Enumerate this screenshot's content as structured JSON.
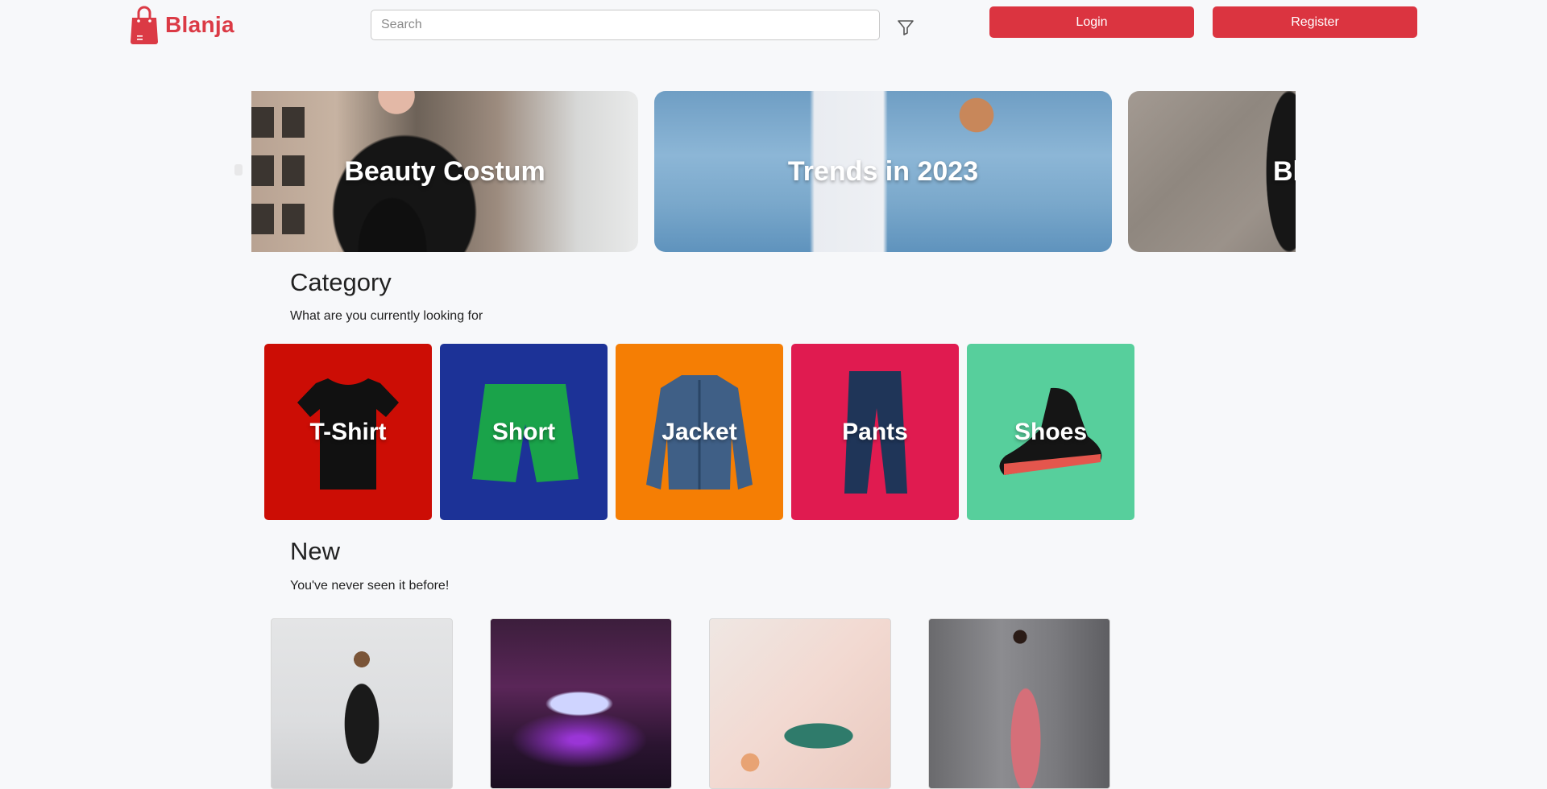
{
  "header": {
    "brand": "Blanja",
    "search": {
      "placeholder": "Search",
      "value": ""
    },
    "login_label": "Login",
    "register_label": "Register"
  },
  "banners": [
    {
      "title": "Beauty Costum"
    },
    {
      "title": "Trends in 2023"
    },
    {
      "title": "Bla"
    }
  ],
  "category": {
    "title": "Category",
    "subtitle": "What are you currently looking for",
    "items": [
      {
        "label": "T-Shirt",
        "color": "#cc0d05"
      },
      {
        "label": "Short",
        "color": "#1c3297"
      },
      {
        "label": "Jacket",
        "color": "#f57e04"
      },
      {
        "label": "Pants",
        "color": "#e01b50"
      },
      {
        "label": "Shoes",
        "color": "#57cf9c"
      }
    ]
  },
  "new": {
    "title": "New",
    "subtitle": "You've never seen it before!"
  },
  "colors": {
    "brand": "#db3a45",
    "button": "#db3440",
    "background": "#f7f8fa"
  },
  "icons": {
    "logo": "shopping-bag-icon",
    "filter": "filter-icon"
  }
}
